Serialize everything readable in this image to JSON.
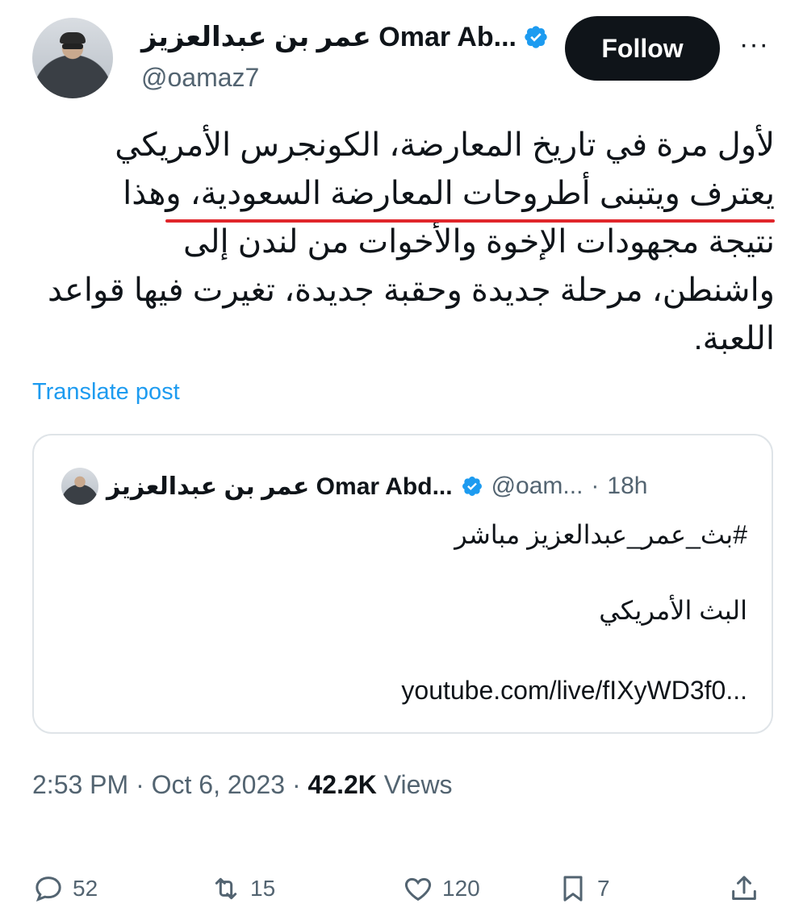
{
  "author": {
    "name": "عمر بن عبدالعزيز Omar Ab...",
    "handle": "@oamaz7",
    "verified_color": "#1d9bf0"
  },
  "follow_label": "Follow",
  "more_label": "···",
  "post_lines": [
    "لأول مرة في تاريخ المعارضة، الكونجرس الأمريكي",
    "يعترف ويتبنى أطروحات المعارضة السعودية، وهذا",
    "نتيجة مجهودات الإخوة والأخوات من لندن إلى",
    "واشنطن، مرحلة جديدة وحقبة جديدة، تغيرت فيها قواعد",
    "اللعبة."
  ],
  "highlight_color": "#e0262b",
  "translate_label": "Translate post",
  "quote": {
    "name": "عمر بن عبدالعزيز Omar Abd...",
    "handle": "@oam...",
    "dot": "·",
    "time": "18h",
    "line1": "#بث_عمر_عبدالعزيز مباشر",
    "line2": "البث الأمريكي",
    "link": "youtube.com/live/fIXyWD3f0..."
  },
  "meta": {
    "time": "2:53 PM",
    "sep1": "·",
    "date": "Oct 6, 2023",
    "sep2": "·",
    "views_count": "42.2K",
    "views_label": "Views"
  },
  "actions": {
    "replies": "52",
    "reposts": "15",
    "likes": "120",
    "bookmarks": "7"
  }
}
